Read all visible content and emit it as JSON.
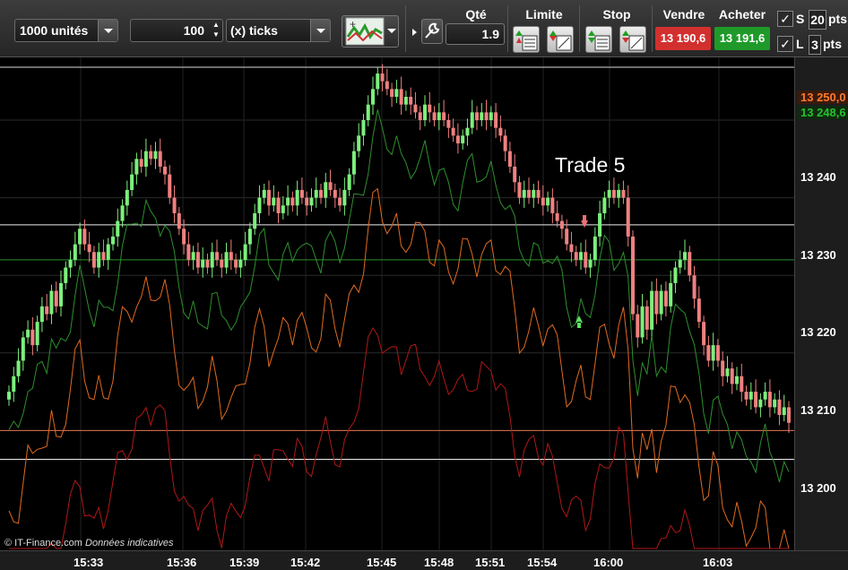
{
  "toolbar": {
    "quantity_select": "1000 unités",
    "ticks_value": "100",
    "ticks_unit_select": "(x) ticks",
    "indicator_icon": "indicators-icon",
    "wrench_icon": "wrench-icon",
    "qty_label": "Qté",
    "qty_value": "1.9",
    "limit_label": "Limite",
    "stop_label": "Stop",
    "sell_label": "Vendre",
    "buy_label": "Acheter",
    "sell_price": "13 190,6",
    "buy_price": "13 191,6",
    "s_label": "S",
    "s_value": "20",
    "s_unit": "pts",
    "l_label": "L",
    "l_value": "3",
    "l_unit": "pts",
    "colors": {
      "sell": "#d2302f",
      "buy": "#1f9a2a"
    }
  },
  "chart": {
    "annotation": "Trade 5",
    "watermark_brand": "© IT-Finance.com",
    "watermark_note": "Données indicatives",
    "price_label_orange": "13 250,0",
    "price_label_green": "13 248,6",
    "y_ticks": [
      "13 240",
      "13 230",
      "13 220",
      "13 210",
      "13 200"
    ],
    "x_ticks": [
      "15:33",
      "15:36",
      "15:39",
      "15:42",
      "15:45",
      "15:48",
      "15:51",
      "15:54",
      "16:00",
      "16:03"
    ],
    "colors": {
      "up": "#7cf07c",
      "down": "#f08080",
      "green_line": "#2e8f2e",
      "orange_line": "#e06a20",
      "red_line": "#b01818"
    }
  },
  "chart_data": {
    "type": "candlestick",
    "ylim": [
      13192,
      13256
    ],
    "y_ticks": [
      13240,
      13230,
      13220,
      13210,
      13200
    ],
    "closes": [
      13205,
      13207,
      13209,
      13212,
      13213,
      13211,
      13214,
      13216,
      13215,
      13218,
      13216,
      13219,
      13221,
      13222,
      13224,
      13226,
      13224,
      13223,
      13221,
      13223,
      13222,
      13224,
      13225,
      13227,
      13229,
      13231,
      13233,
      13235,
      13234,
      13236,
      13235,
      13236,
      13234,
      13233,
      13230,
      13228,
      13226,
      13224,
      13222,
      13223,
      13221,
      13222,
      13221,
      13223,
      13222,
      13221,
      13223,
      13222,
      13221,
      13222,
      13224,
      13226,
      13228,
      13230,
      13231,
      13229,
      13230,
      13228,
      13229,
      13230,
      13229,
      13231,
      13230,
      13229,
      13230,
      13231,
      13230,
      13232,
      13231,
      13230,
      13229,
      13231,
      13233,
      13236,
      13238,
      13240,
      13242,
      13244,
      13246,
      13245,
      13244,
      13243,
      13244,
      13242,
      13243,
      13242,
      13241,
      13240,
      13242,
      13241,
      13240,
      13241,
      13240,
      13239,
      13238,
      13237,
      13238,
      13239,
      13241,
      13240,
      13241,
      13240,
      13241,
      13239,
      13238,
      13236,
      13234,
      13232,
      13230,
      13231,
      13230,
      13231,
      13230,
      13229,
      13230,
      13228,
      13227,
      13226,
      13224,
      13223,
      13222,
      13223,
      13221,
      13222,
      13225,
      13228,
      13230,
      13231,
      13230,
      13231,
      13230,
      13225,
      13215,
      13212,
      13216,
      13213,
      13218,
      13215,
      13218,
      13216,
      13219,
      13221,
      13222,
      13223,
      13220,
      13217,
      13214,
      13211,
      13209,
      13211,
      13209,
      13207,
      13208,
      13206,
      13207,
      13205,
      13204,
      13205,
      13203,
      13204,
      13205,
      13203,
      13204,
      13202,
      13203,
      13201
    ]
  }
}
